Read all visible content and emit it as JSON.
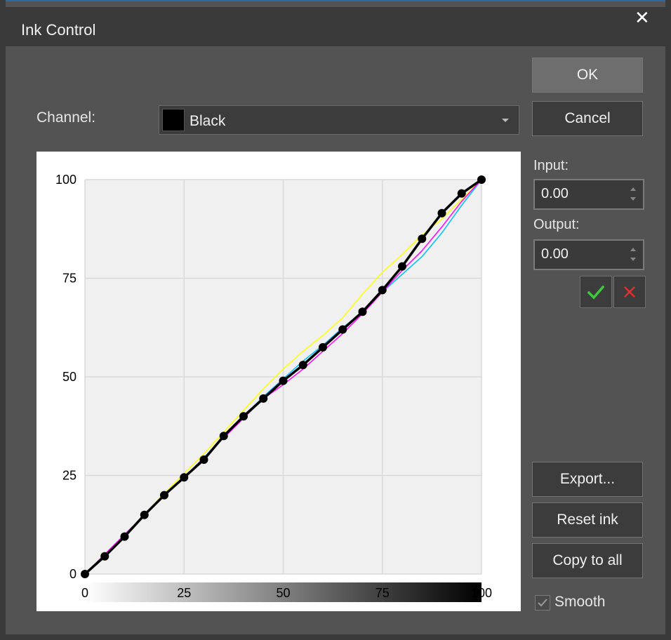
{
  "window": {
    "title": "Ink Control",
    "close_glyph": "✕"
  },
  "channel": {
    "label": "Channel:",
    "value": "Black",
    "swatch_color": "#000000"
  },
  "buttons": {
    "ok": "OK",
    "cancel": "Cancel",
    "export": "Export...",
    "reset_ink": "Reset ink",
    "copy_to_all": "Copy to all"
  },
  "input": {
    "label": "Input:",
    "value": "0.00"
  },
  "output": {
    "label": "Output:",
    "value": "0.00"
  },
  "smooth": {
    "label": "Smooth",
    "checked": true
  },
  "icons": {
    "apply": "check-icon",
    "discard": "x-icon"
  },
  "colors": {
    "apply": "#3fc83f",
    "discard": "#e03030"
  },
  "chart_data": {
    "type": "line",
    "xlim": [
      0,
      100
    ],
    "ylim": [
      0,
      100
    ],
    "xticks": [
      0,
      25,
      50,
      75,
      100
    ],
    "yticks": [
      0,
      25,
      50,
      75,
      100
    ],
    "grid": true,
    "series": [
      {
        "color": "#ffff00",
        "x": [
          0,
          5,
          10,
          15,
          20,
          25,
          30,
          35,
          40,
          45,
          50,
          55,
          60,
          65,
          70,
          75,
          80,
          85,
          90,
          95,
          100
        ],
        "y": [
          0,
          5,
          10,
          15,
          20.5,
          25.5,
          30.5,
          36,
          41.5,
          47,
          52,
          56.5,
          60.5,
          65,
          71,
          76.5,
          81,
          86,
          90,
          95,
          100
        ]
      },
      {
        "color": "#00bfff",
        "x": [
          0,
          5,
          10,
          15,
          20,
          25,
          30,
          35,
          40,
          45,
          50,
          55,
          60,
          65,
          70,
          75,
          80,
          85,
          90,
          95,
          100
        ],
        "y": [
          0,
          5,
          10,
          15,
          20,
          24.5,
          29.5,
          35,
          40,
          45,
          49.5,
          54,
          58,
          62.5,
          66.5,
          71.5,
          76,
          80.5,
          86.5,
          93.5,
          100
        ]
      },
      {
        "color": "#ff00ff",
        "x": [
          0,
          5,
          10,
          15,
          20,
          25,
          30,
          35,
          40,
          45,
          50,
          55,
          60,
          65,
          70,
          75,
          80,
          85,
          90,
          95,
          100
        ],
        "y": [
          0,
          5,
          10,
          15,
          20,
          24.5,
          29.5,
          34.5,
          39.5,
          44.5,
          48,
          52,
          56.5,
          61,
          66,
          71.5,
          77,
          82,
          88,
          94.5,
          100
        ]
      },
      {
        "name": "Black",
        "color": "#000000",
        "x": [
          0,
          5,
          10,
          15,
          20,
          25,
          30,
          35,
          40,
          45,
          50,
          55,
          60,
          65,
          70,
          75,
          80,
          85,
          90,
          95,
          100
        ],
        "y": [
          0,
          4.5,
          9.5,
          15,
          20,
          24.5,
          29,
          35,
          40,
          44.5,
          49,
          53,
          57.5,
          62,
          66.5,
          72,
          78,
          85,
          91.5,
          96.5,
          100
        ],
        "markers": true
      }
    ]
  }
}
